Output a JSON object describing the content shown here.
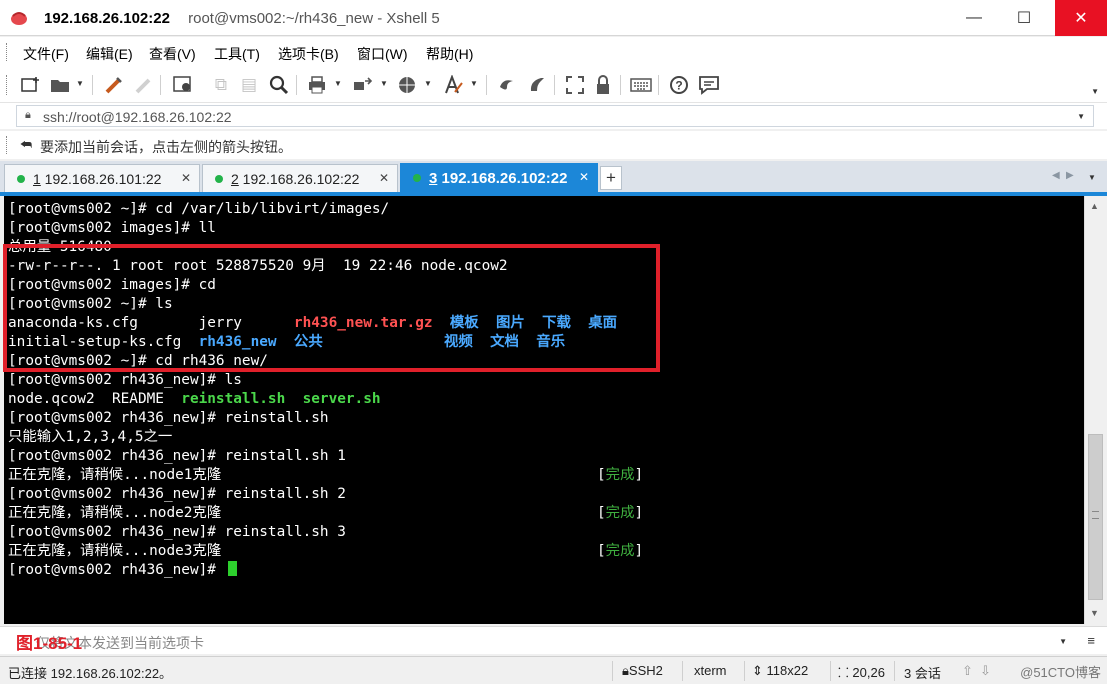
{
  "window": {
    "host_title": "192.168.26.102:22",
    "subtitle": "root@vms002:~/rh436_new - Xshell 5",
    "minimize_glyph": "—",
    "maximize_glyph": "☐",
    "close_glyph": "✕"
  },
  "menu": {
    "items": [
      {
        "label": "文件(F)"
      },
      {
        "label": "编辑(E)"
      },
      {
        "label": "查看(V)"
      },
      {
        "label": "工具(T)"
      },
      {
        "label": "选项卡(B)"
      },
      {
        "label": "窗口(W)"
      },
      {
        "label": "帮助(H)"
      }
    ]
  },
  "toolbar": {
    "icons": [
      "new-session-icon",
      "open-folder-icon",
      "reconnect-icon",
      "disconnect-icon",
      "properties-icon",
      "copy-icon",
      "paste-icon",
      "find-icon",
      "print-icon",
      "transfer-icon",
      "globe-icon",
      "font-icon",
      "xshell-icon",
      "xftp-icon",
      "fullscreen-icon",
      "lock-icon",
      "keyboard-icon",
      "help-icon",
      "chat-icon"
    ]
  },
  "address": {
    "value": "ssh://root@192.168.26.102:22"
  },
  "hint": {
    "text": "要添加当前会话，点击左侧的箭头按钮。"
  },
  "tabs": [
    {
      "number": "1",
      "host": " 192.168.26.101:22",
      "active": false,
      "status_color": "#23b34a"
    },
    {
      "number": "2",
      "host": " 192.168.26.102:22",
      "active": false,
      "status_color": "#23b34a"
    },
    {
      "number": "3",
      "host": " 192.168.26.102:22",
      "active": true,
      "status_color": "#23b34a"
    }
  ],
  "tab_new_label": "+",
  "terminal": {
    "lines": [
      {
        "segments": [
          {
            "text": "[root@vms002 ~]# cd /var/lib/libvirt/images/"
          }
        ]
      },
      {
        "segments": [
          {
            "text": "[root@vms002 images]# ll"
          }
        ]
      },
      {
        "segments": [
          {
            "text": "总用量 516480"
          }
        ]
      },
      {
        "segments": [
          {
            "text": "-rw-r--r--. 1 root root 528875520 9月  19 22:46 node.qcow2"
          }
        ]
      },
      {
        "segments": [
          {
            "text": "[root@vms002 images]# cd"
          }
        ]
      },
      {
        "segments": [
          {
            "text": "[root@vms002 ~]# ls"
          }
        ]
      },
      {
        "segments": [
          {
            "text": "anaconda-ks.cfg       jerry      "
          },
          {
            "text": "rh436_new.tar.gz",
            "color": "red"
          },
          {
            "text": "  "
          },
          {
            "text": "模板",
            "color": "blue"
          },
          {
            "text": "  "
          },
          {
            "text": "图片",
            "color": "blue"
          },
          {
            "text": "  "
          },
          {
            "text": "下载",
            "color": "blue"
          },
          {
            "text": "  "
          },
          {
            "text": "桌面",
            "color": "blue"
          }
        ]
      },
      {
        "segments": [
          {
            "text": "initial-setup-ks.cfg  "
          },
          {
            "text": "rh436_new",
            "color": "blue"
          },
          {
            "text": "  "
          },
          {
            "text": "公共",
            "color": "blue"
          },
          {
            "text": "              "
          },
          {
            "text": "视频",
            "color": "blue"
          },
          {
            "text": "  "
          },
          {
            "text": "文档",
            "color": "blue"
          },
          {
            "text": "  "
          },
          {
            "text": "音乐",
            "color": "blue"
          }
        ]
      },
      {
        "segments": [
          {
            "text": "[root@vms002 ~]# cd rh436_new/"
          }
        ]
      },
      {
        "segments": [
          {
            "text": "[root@vms002 rh436_new]# ls"
          }
        ]
      },
      {
        "segments": [
          {
            "text": "node.qcow2  README  "
          },
          {
            "text": "reinstall.sh",
            "color": "green"
          },
          {
            "text": "  "
          },
          {
            "text": "server.sh",
            "color": "green"
          }
        ]
      },
      {
        "segments": [
          {
            "text": "[root@vms002 rh436_new]# reinstall.sh"
          }
        ]
      },
      {
        "segments": [
          {
            "text": "只能输入1,2,3,4,5之一"
          }
        ]
      },
      {
        "segments": [
          {
            "text": "[root@vms002 rh436_new]# reinstall.sh 1"
          }
        ]
      },
      {
        "segments": [
          {
            "text": "正在克隆，请稍候...node1克隆"
          }
        ],
        "status": "完成"
      },
      {
        "segments": [
          {
            "text": "[root@vms002 rh436_new]# reinstall.sh 2"
          }
        ]
      },
      {
        "segments": [
          {
            "text": "正在克隆，请稍候...node2克隆"
          }
        ],
        "status": "完成"
      },
      {
        "segments": [
          {
            "text": "[root@vms002 rh436_new]# reinstall.sh 3"
          }
        ]
      },
      {
        "segments": [
          {
            "text": "正在克隆，请稍候...node3克隆"
          }
        ],
        "status": "完成"
      },
      {
        "segments": [
          {
            "text": "[root@vms002 rh436_new]# "
          }
        ],
        "cursor": true
      }
    ],
    "colors": {
      "red": "#ff5252",
      "blue": "#4aa9ff",
      "green": "#4bd84b",
      "status_green": "#3fae3f",
      "highlight": "#e0202a"
    }
  },
  "sendbar": {
    "placeholder": "仅将文本发送到当前选项卡",
    "figure_label": "图1-85-1"
  },
  "status": {
    "connection": "已连接 192.168.26.102:22。",
    "protocol": "SSH2",
    "terminal_type": "xterm",
    "size": "118x22",
    "cursor_pos": "20,26",
    "sessions": "3 会话",
    "watermark": "@51CTO博客"
  }
}
